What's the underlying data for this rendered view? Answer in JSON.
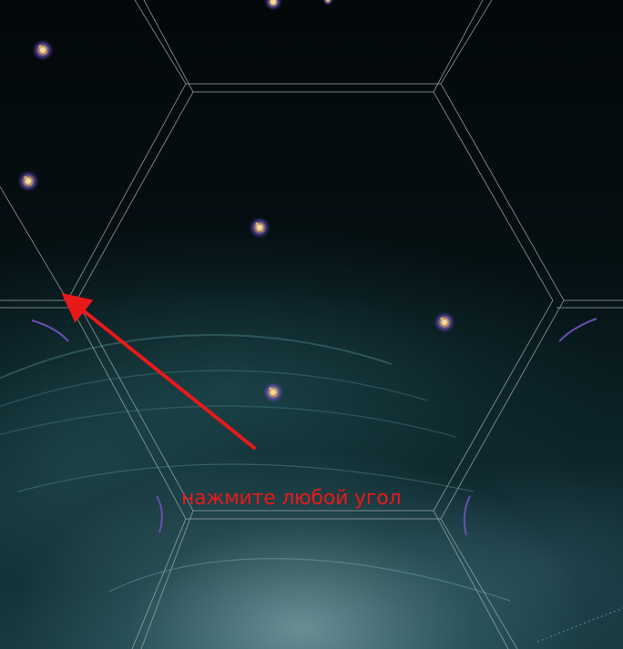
{
  "hint": {
    "text": "нажмите любой угол"
  },
  "colors": {
    "hex_border": "#9aa6a8",
    "arrow": "#e8191b",
    "hint_text": "#e8191b",
    "sector_arc": "#6a4fb0",
    "star_glow": "#7a5ad8",
    "star_core": "#f3d9a6"
  },
  "icons": {
    "arrow": "red-arrow-pointer",
    "systems": "star-system-icon"
  }
}
